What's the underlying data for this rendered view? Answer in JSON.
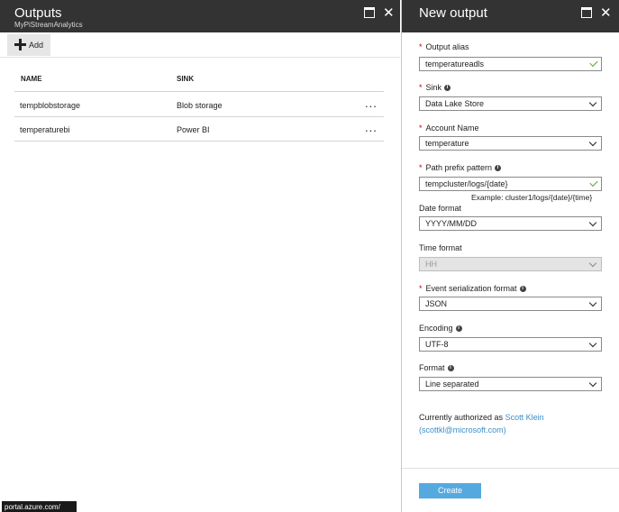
{
  "outputs_blade": {
    "title": "Outputs",
    "subtitle": "MyPiStreamAnalytics",
    "toolbar": {
      "add_label": "Add"
    },
    "table": {
      "headers": [
        "NAME",
        "SINK"
      ],
      "rows": [
        {
          "name": "tempblobstorage",
          "sink": "Blob storage",
          "more": "..."
        },
        {
          "name": "temperaturebi",
          "sink": "Power BI",
          "more": "..."
        }
      ]
    },
    "status_url": "portal.azure.com/"
  },
  "new_output_blade": {
    "title": "New output",
    "required_mark": "*",
    "info_glyph": "i",
    "fields": {
      "output_alias": {
        "label": "Output alias",
        "value": "temperatureadls"
      },
      "sink": {
        "label": "Sink",
        "value": "Data Lake Store"
      },
      "account_name": {
        "label": "Account Name",
        "value": "temperature"
      },
      "path_prefix": {
        "label": "Path prefix pattern",
        "value": "tempcluster/logs/{date}",
        "example": "Example: cluster1/logs/{date}/{time}"
      },
      "date_format": {
        "label": "Date format",
        "value": "YYYY/MM/DD"
      },
      "time_format": {
        "label": "Time format",
        "value": "HH"
      },
      "event_serialization": {
        "label": "Event serialization format",
        "value": "JSON"
      },
      "encoding": {
        "label": "Encoding",
        "value": "UTF-8"
      },
      "format": {
        "label": "Format",
        "value": "Line separated"
      }
    },
    "authorization": {
      "prefix": "Currently authorized as",
      "user_name": "Scott Klein",
      "user_email": "(scottkl@microsoft.com)"
    },
    "create_label": "Create"
  },
  "colors": {
    "header_bg": "#333333",
    "required": "#c00000",
    "valid_check": "#5ba532",
    "link": "#3a8fc6",
    "primary_button": "#56a9df"
  },
  "icons": [
    "maximize-icon",
    "close-icon",
    "plus-icon",
    "more-icon",
    "info-icon",
    "check-icon",
    "chevron-down-icon"
  ]
}
